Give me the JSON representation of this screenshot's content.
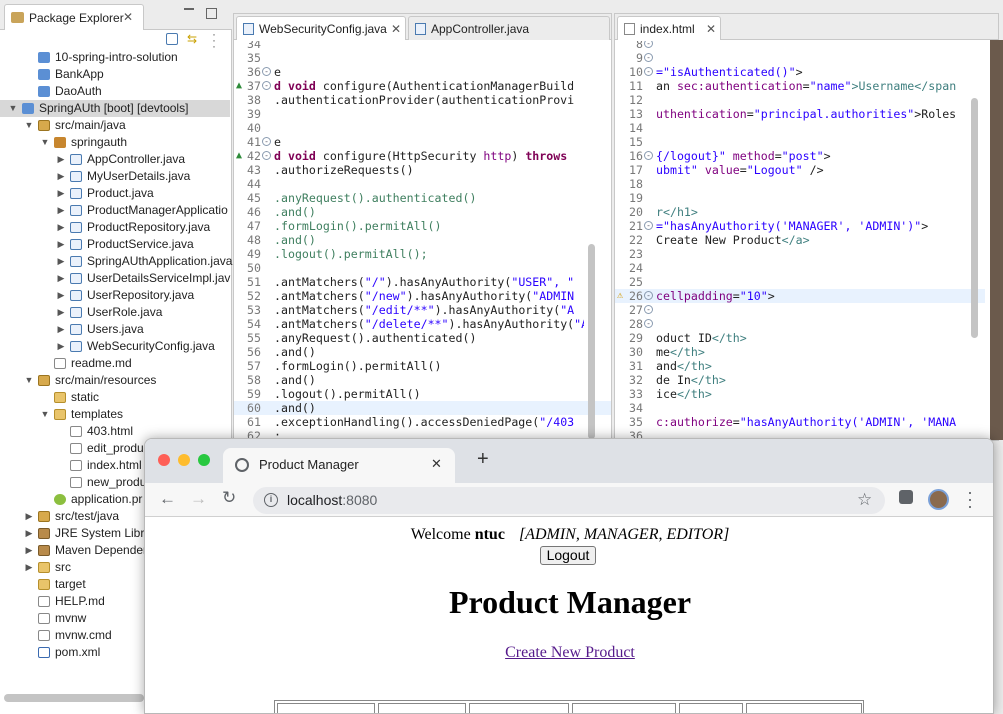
{
  "package_explorer": {
    "title": "Package Explorer",
    "tree": [
      {
        "label": "10-spring-intro-solution",
        "level": 1,
        "twisty": "",
        "icon": "project"
      },
      {
        "label": "BankApp",
        "level": 1,
        "twisty": "",
        "icon": "project"
      },
      {
        "label": "DaoAuth",
        "level": 1,
        "twisty": "",
        "icon": "project"
      },
      {
        "label": "SpringAUth [boot] [devtools]",
        "level": 0,
        "twisty": "▼",
        "icon": "project",
        "selected": true
      },
      {
        "label": "src/main/java",
        "level": 1,
        "twisty": "▼",
        "icon": "srcfolder"
      },
      {
        "label": "springauth",
        "level": 2,
        "twisty": "▼",
        "icon": "package"
      },
      {
        "label": "AppController.java",
        "level": 3,
        "twisty": "▶",
        "icon": "java"
      },
      {
        "label": "MyUserDetails.java",
        "level": 3,
        "twisty": "▶",
        "icon": "java"
      },
      {
        "label": "Product.java",
        "level": 3,
        "twisty": "▶",
        "icon": "java"
      },
      {
        "label": "ProductManagerApplicatio",
        "level": 3,
        "twisty": "▶",
        "icon": "java"
      },
      {
        "label": "ProductRepository.java",
        "level": 3,
        "twisty": "▶",
        "icon": "java"
      },
      {
        "label": "ProductService.java",
        "level": 3,
        "twisty": "▶",
        "icon": "java"
      },
      {
        "label": "SpringAUthApplication.java",
        "level": 3,
        "twisty": "▶",
        "icon": "java"
      },
      {
        "label": "UserDetailsServiceImpl.jav",
        "level": 3,
        "twisty": "▶",
        "icon": "java"
      },
      {
        "label": "UserRepository.java",
        "level": 3,
        "twisty": "▶",
        "icon": "java"
      },
      {
        "label": "UserRole.java",
        "level": 3,
        "twisty": "▶",
        "icon": "java"
      },
      {
        "label": "Users.java",
        "level": 3,
        "twisty": "▶",
        "icon": "java"
      },
      {
        "label": "WebSecurityConfig.java",
        "level": 3,
        "twisty": "▶",
        "icon": "java"
      },
      {
        "label": "readme.md",
        "level": 2,
        "twisty": "",
        "icon": "file"
      },
      {
        "label": "src/main/resources",
        "level": 1,
        "twisty": "▼",
        "icon": "srcfolder"
      },
      {
        "label": "static",
        "level": 2,
        "twisty": "",
        "icon": "folder"
      },
      {
        "label": "templates",
        "level": 2,
        "twisty": "▼",
        "icon": "folder"
      },
      {
        "label": "403.html",
        "level": 3,
        "twisty": "",
        "icon": "file"
      },
      {
        "label": "edit_produ",
        "level": 3,
        "twisty": "",
        "icon": "file"
      },
      {
        "label": "index.html",
        "level": 3,
        "twisty": "",
        "icon": "file"
      },
      {
        "label": "new_produ",
        "level": 3,
        "twisty": "",
        "icon": "file"
      },
      {
        "label": "application.pr",
        "level": 2,
        "twisty": "",
        "icon": "props"
      },
      {
        "label": "src/test/java",
        "level": 1,
        "twisty": "▶",
        "icon": "srcfolder"
      },
      {
        "label": "JRE System Libra",
        "level": 1,
        "twisty": "▶",
        "icon": "library"
      },
      {
        "label": "Maven Depender",
        "level": 1,
        "twisty": "▶",
        "icon": "library"
      },
      {
        "label": "src",
        "level": 1,
        "twisty": "▶",
        "icon": "folder"
      },
      {
        "label": "target",
        "level": 1,
        "twisty": "",
        "icon": "folder"
      },
      {
        "label": "HELP.md",
        "level": 1,
        "twisty": "",
        "icon": "file"
      },
      {
        "label": "mvnw",
        "level": 1,
        "twisty": "",
        "icon": "file"
      },
      {
        "label": "mvnw.cmd",
        "level": 1,
        "twisty": "",
        "icon": "file"
      },
      {
        "label": "pom.xml",
        "level": 1,
        "twisty": "",
        "icon": "xml"
      }
    ]
  },
  "java_editor": {
    "tabs": [
      "WebSecurityConfig.java",
      "AppController.java"
    ],
    "lines": [
      {
        "n": "34",
        "parts": []
      },
      {
        "n": "35",
        "parts": []
      },
      {
        "n": "36",
        "fold": true,
        "parts": [
          {
            "t": "e"
          }
        ]
      },
      {
        "n": "37",
        "fold": true,
        "marker": "override",
        "parts": [
          {
            "t": "d ",
            "c": "kw"
          },
          {
            "t": "void",
            "c": "kw"
          },
          {
            "t": " configure(AuthenticationManagerBuild"
          }
        ]
      },
      {
        "n": "38",
        "parts": [
          {
            "t": ".authenticationProvider(authenticationProvi"
          }
        ]
      },
      {
        "n": "39",
        "parts": []
      },
      {
        "n": "40",
        "parts": []
      },
      {
        "n": "41",
        "fold": true,
        "parts": [
          {
            "t": "e"
          }
        ]
      },
      {
        "n": "42",
        "fold": true,
        "marker": "override",
        "parts": [
          {
            "t": "d ",
            "c": "kw"
          },
          {
            "t": "void",
            "c": "kw"
          },
          {
            "t": " configure(HttpSecurity "
          },
          {
            "t": "http",
            "c": "attr"
          },
          {
            "t": ") "
          },
          {
            "t": "throws",
            "c": "kw"
          }
        ]
      },
      {
        "n": "43",
        "parts": [
          {
            "t": ".authorizeRequests()"
          }
        ]
      },
      {
        "n": "44",
        "parts": []
      },
      {
        "n": "45",
        "parts": [
          {
            "t": ".anyRequest().authenticated()",
            "c": "gr"
          }
        ]
      },
      {
        "n": "46",
        "parts": [
          {
            "t": ".and()",
            "c": "gr"
          }
        ]
      },
      {
        "n": "47",
        "parts": [
          {
            "t": ".formLogin().permitAll()",
            "c": "gr"
          }
        ]
      },
      {
        "n": "48",
        "parts": [
          {
            "t": ".and()",
            "c": "gr"
          }
        ]
      },
      {
        "n": "49",
        "parts": [
          {
            "t": ".logout().permitAll();",
            "c": "gr"
          }
        ]
      },
      {
        "n": "50",
        "parts": []
      },
      {
        "n": "51",
        "parts": [
          {
            "t": ".antMatchers("
          },
          {
            "t": "\"/\"",
            "c": "str"
          },
          {
            "t": ").hasAnyAuthority("
          },
          {
            "t": "\"USER\", \"",
            "c": "str"
          }
        ]
      },
      {
        "n": "52",
        "parts": [
          {
            "t": ".antMatchers("
          },
          {
            "t": "\"/new\"",
            "c": "str"
          },
          {
            "t": ").hasAnyAuthority("
          },
          {
            "t": "\"ADMIN",
            "c": "str"
          }
        ]
      },
      {
        "n": "53",
        "parts": [
          {
            "t": ".antMatchers("
          },
          {
            "t": "\"/edit/**\"",
            "c": "str"
          },
          {
            "t": ").hasAnyAuthority("
          },
          {
            "t": "\"A",
            "c": "str"
          }
        ]
      },
      {
        "n": "54",
        "parts": [
          {
            "t": ".antMatchers("
          },
          {
            "t": "\"/delete/**\"",
            "c": "str"
          },
          {
            "t": ").hasAnyAuthority("
          },
          {
            "t": "\"AD",
            "c": "str"
          }
        ]
      },
      {
        "n": "55",
        "parts": [
          {
            "t": ".anyRequest().authenticated()"
          }
        ]
      },
      {
        "n": "56",
        "parts": [
          {
            "t": ".and()"
          }
        ]
      },
      {
        "n": "57",
        "parts": [
          {
            "t": ".formLogin().permitAll()"
          }
        ]
      },
      {
        "n": "58",
        "parts": [
          {
            "t": ".and()"
          }
        ]
      },
      {
        "n": "59",
        "parts": [
          {
            "t": ".logout().permitAll()"
          }
        ]
      },
      {
        "n": "60",
        "current": true,
        "parts": [
          {
            "t": ".and()"
          }
        ]
      },
      {
        "n": "61",
        "parts": [
          {
            "t": ".exceptionHandling().accessDeniedPage("
          },
          {
            "t": "\"/403",
            "c": "str"
          }
        ]
      },
      {
        "n": "62",
        "parts": [
          {
            "t": ";"
          }
        ]
      }
    ]
  },
  "html_editor": {
    "tab": "index.html",
    "lines": [
      {
        "n": "8",
        "fold": true,
        "parts": []
      },
      {
        "n": "9",
        "fold": true,
        "parts": []
      },
      {
        "n": "10",
        "fold": true,
        "parts": [
          {
            "t": "=\"isAuthenticated()\"",
            "c": "str"
          },
          {
            "t": ">"
          }
        ]
      },
      {
        "n": "11",
        "parts": [
          {
            "t": "an "
          },
          {
            "t": "sec:authentication",
            "c": "attr"
          },
          {
            "t": "="
          },
          {
            "t": "\"name\"",
            "c": "str"
          },
          {
            "t": ">Username</span",
            "c": "tag"
          }
        ]
      },
      {
        "n": "12",
        "parts": []
      },
      {
        "n": "13",
        "parts": [
          {
            "t": "uthentication",
            "c": "attr"
          },
          {
            "t": "="
          },
          {
            "t": "\"principal.authorities\"",
            "c": "str"
          },
          {
            "t": ">Roles"
          }
        ]
      },
      {
        "n": "14",
        "parts": []
      },
      {
        "n": "15",
        "parts": []
      },
      {
        "n": "16",
        "fold": true,
        "parts": [
          {
            "t": "{/logout}\"",
            "c": "str"
          },
          {
            "t": " method",
            "c": "attr"
          },
          {
            "t": "="
          },
          {
            "t": "\"post\"",
            "c": "str"
          },
          {
            "t": ">"
          }
        ]
      },
      {
        "n": "17",
        "parts": [
          {
            "t": "ubmit\"",
            "c": "str"
          },
          {
            "t": " value",
            "c": "attr"
          },
          {
            "t": "="
          },
          {
            "t": "\"Logout\"",
            "c": "str"
          },
          {
            "t": " />"
          }
        ]
      },
      {
        "n": "18",
        "parts": []
      },
      {
        "n": "19",
        "parts": []
      },
      {
        "n": "20",
        "parts": [
          {
            "t": "r</h1>",
            "c": "tag"
          }
        ]
      },
      {
        "n": "21",
        "fold": true,
        "parts": [
          {
            "t": "=\"hasAnyAuthority('MANAGER', 'ADMIN')\"",
            "c": "str"
          },
          {
            "t": ">"
          }
        ]
      },
      {
        "n": "22",
        "parts": [
          {
            "t": "Create New Product"
          },
          {
            "t": "</a>",
            "c": "tag"
          }
        ]
      },
      {
        "n": "23",
        "parts": []
      },
      {
        "n": "24",
        "parts": []
      },
      {
        "n": "25",
        "parts": []
      },
      {
        "n": "26",
        "fold": true,
        "marker": "warning",
        "current": true,
        "parts": [
          {
            "t": "cellpadding",
            "c": "attr"
          },
          {
            "t": "="
          },
          {
            "t": "\"10\"",
            "c": "str"
          },
          {
            "t": ">"
          }
        ]
      },
      {
        "n": "27",
        "fold": true,
        "parts": []
      },
      {
        "n": "28",
        "fold": true,
        "parts": []
      },
      {
        "n": "29",
        "parts": [
          {
            "t": "oduct ID"
          },
          {
            "t": "</th>",
            "c": "tag"
          }
        ]
      },
      {
        "n": "30",
        "parts": [
          {
            "t": "me"
          },
          {
            "t": "</th>",
            "c": "tag"
          }
        ]
      },
      {
        "n": "31",
        "parts": [
          {
            "t": "and"
          },
          {
            "t": "</th>",
            "c": "tag"
          }
        ]
      },
      {
        "n": "32",
        "parts": [
          {
            "t": "de In"
          },
          {
            "t": "</th>",
            "c": "tag"
          }
        ]
      },
      {
        "n": "33",
        "parts": [
          {
            "t": "ice"
          },
          {
            "t": "</th>",
            "c": "tag"
          }
        ]
      },
      {
        "n": "34",
        "parts": []
      },
      {
        "n": "35",
        "parts": [
          {
            "t": "c:authorize",
            "c": "attr"
          },
          {
            "t": "="
          },
          {
            "t": "\"hasAnyAuthority('ADMIN', 'MANA",
            "c": "str"
          }
        ]
      },
      {
        "n": "36",
        "parts": []
      }
    ]
  },
  "browser": {
    "tab_title": "Product Manager",
    "url_host": "localhost",
    "url_port": ":8080",
    "page": {
      "welcome_prefix": "Welcome",
      "username": "ntuc",
      "roles": "[ADMIN, MANAGER, EDITOR]",
      "logout_label": "Logout",
      "heading": "Product Manager",
      "create_link": "Create New Product"
    }
  },
  "colors": {
    "link": "#551a8b",
    "keyword": "#7f0055",
    "string": "#2a00ff",
    "selection": "#d8d8d8"
  },
  "icons": [
    "close-icon",
    "minimize-icon",
    "maximize-icon",
    "collapse-all-icon",
    "link-editor-icon",
    "view-menu-icon",
    "back-icon",
    "forward-icon",
    "reload-icon",
    "info-icon",
    "star-icon",
    "extensions-icon",
    "profile-avatar",
    "more-icon",
    "globe-icon",
    "new-tab-icon"
  ]
}
